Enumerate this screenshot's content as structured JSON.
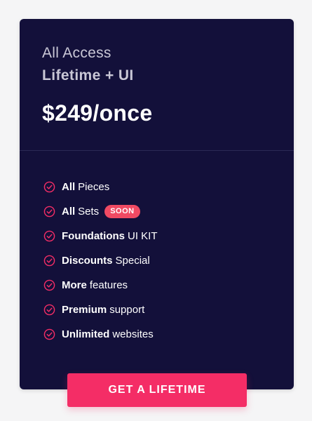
{
  "plan": {
    "name": "All Access",
    "subtitle": "Lifetime + UI",
    "price": "$249/once"
  },
  "features": [
    {
      "strong": "All",
      "text": "Pieces",
      "badge": ""
    },
    {
      "strong": "All",
      "text": "Sets",
      "badge": "SOON"
    },
    {
      "strong": "Foundations",
      "text": "UI KIT",
      "badge": ""
    },
    {
      "strong": "Discounts",
      "text": "Special",
      "badge": ""
    },
    {
      "strong": "More",
      "text": "features",
      "badge": ""
    },
    {
      "strong": "Premium",
      "text": "support",
      "badge": ""
    },
    {
      "strong": "Unlimited",
      "text": "websites",
      "badge": ""
    }
  ],
  "cta": {
    "label": "GET A LIFETIME"
  },
  "icons": {
    "feature_icon": "check-circle-icon"
  },
  "colors": {
    "card_background": "#13103a",
    "accent": "#f42d66",
    "badge": "#f04a63"
  }
}
